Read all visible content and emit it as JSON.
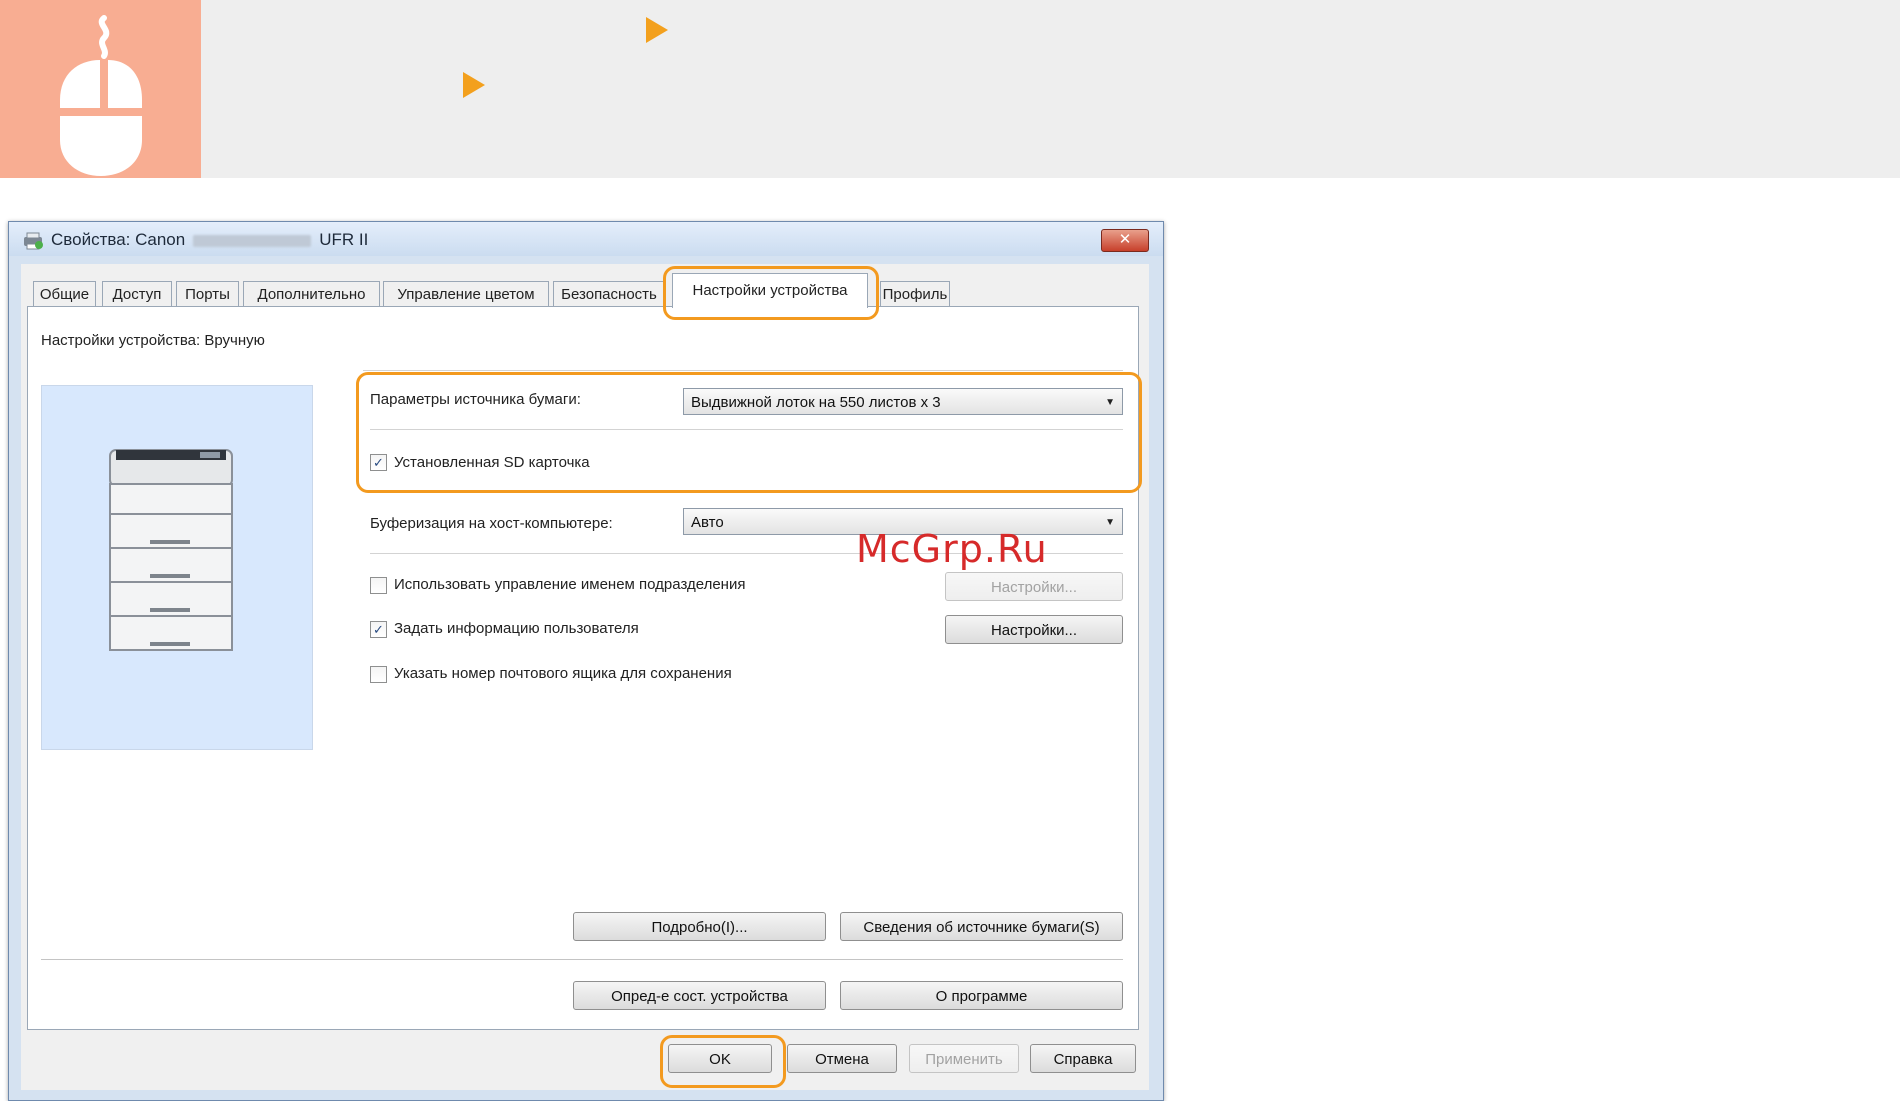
{
  "banner": {
    "icon": "mouse-icon",
    "arrow_icon": "play-arrow-icon",
    "colors": {
      "icon_bg": "#f8ad92",
      "arrow": "#f3a01d",
      "highlight": "#f39a1f"
    }
  },
  "window": {
    "title_prefix": "Свойства: Canon",
    "title_suffix": "UFR II",
    "close_label": "✕"
  },
  "tabs": [
    "Общие",
    "Доступ",
    "Порты",
    "Дополнительно",
    "Управление цветом",
    "Безопасность",
    "Настройки устройства",
    "Профиль"
  ],
  "active_tab": "Настройки устройства",
  "panel": {
    "device_settings_label": "Настройки устройства: Вручную",
    "paper_source_label": "Параметры источника бумаги:",
    "paper_source_value": "Выдвижной лоток на 550 листов x 3",
    "sd_card_label": "Установленная SD карточка",
    "sd_card_checked": true,
    "spooling_label": "Буферизация на хост-компьютере:",
    "spooling_value": "Авто",
    "dept_id_label": "Использовать управление именем подразделения",
    "dept_id_checked": false,
    "user_info_label": "Задать информацию пользователя",
    "user_info_checked": true,
    "mailbox_label": "Указать номер почтового ящика для сохранения",
    "mailbox_checked": false,
    "settings_btn_disabled": "Настройки...",
    "settings_btn": "Настройки...",
    "details_btn": "Подробно(I)...",
    "paper_info_btn": "Сведения об источнике бумаги(S)",
    "get_status_btn": "Опред-е сост. устройства",
    "about_btn": "О программе"
  },
  "footer": {
    "ok": "OK",
    "cancel": "Отмена",
    "apply": "Применить",
    "help": "Справка"
  },
  "watermark": "McGrp.Ru"
}
